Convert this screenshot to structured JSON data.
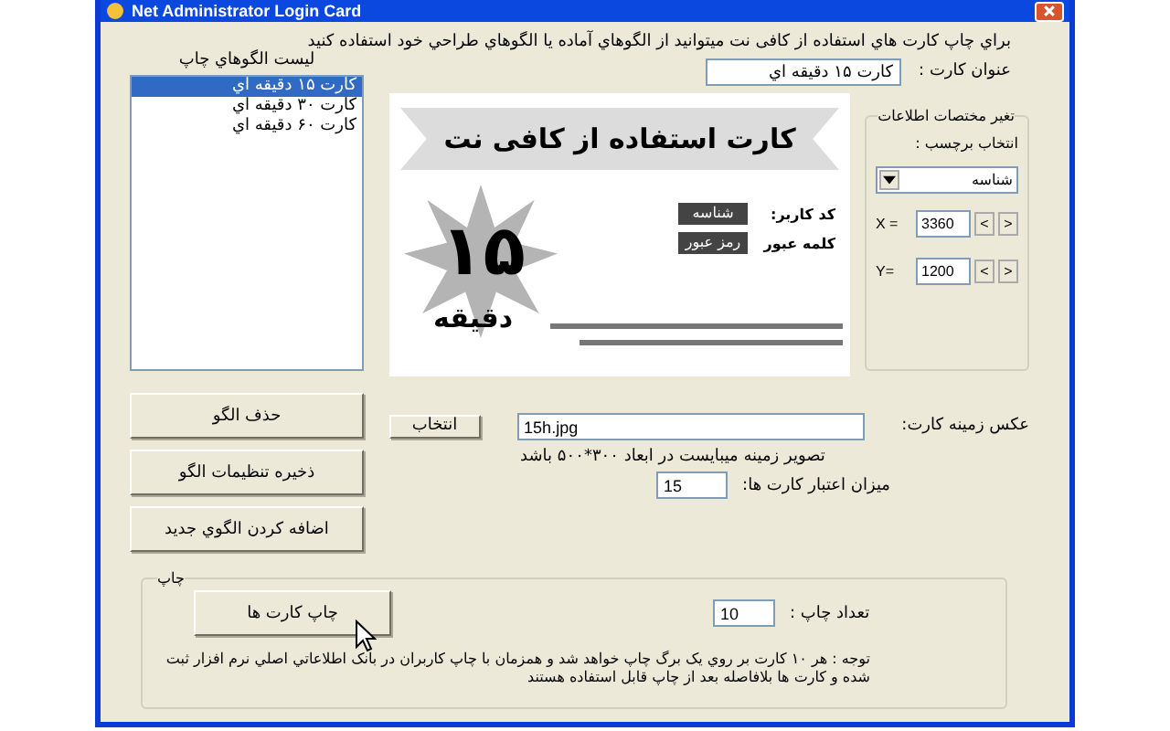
{
  "window": {
    "title": "Net Administrator Login Card"
  },
  "intro": "براي چاپ کارت هاي استفاده از کافی نت میتوانید از الگوهاي آماده یا الگوهاي طراحي خود استفاده کنيد",
  "templates": {
    "heading": "لیست الگوهاي چاپ",
    "items": [
      {
        "label": "کارت ۱۵ دقیقه اي",
        "selected": true
      },
      {
        "label": "کارت ۳۰ دقیقه اي",
        "selected": false
      },
      {
        "label": "کارت ۶۰ دقیقه اي",
        "selected": false
      }
    ]
  },
  "template_buttons": [
    "حذف الگو",
    "ذخیره تنظیمات الگو",
    "اضافه کردن الگوي جدید"
  ],
  "card_title": {
    "label": "عنوان کارت :",
    "value": "کارت ۱۵ دقیقه اي"
  },
  "card_preview": {
    "heading": "کارت استفاده از کافی نت",
    "number": "۱۵",
    "unit": "دقیقه",
    "fields": [
      {
        "label": "کد کاربر:",
        "tag": "شناسه"
      },
      {
        "label": "کلمه عبور",
        "tag": "رمز عبور"
      }
    ]
  },
  "coordinates": {
    "legend": "تغیر مختصات اطلاعات",
    "select_label": "انتخاب برچسب :",
    "select_value": "شناسه",
    "axes": [
      {
        "label": "X =",
        "value": "3360",
        "prev": "<",
        "next": ">"
      },
      {
        "label": "Y=",
        "value": "1200",
        "prev": "<",
        "next": ">"
      }
    ]
  },
  "background": {
    "label": "عکس زمینه کارت:",
    "value": "15h.jpg",
    "browse": "انتخاب",
    "hint": "تصویر زمینه میبایست در ابعاد ۳۰۰*۵۰۰ باشد"
  },
  "validity": {
    "label": "میزان اعتبار کارت ها:",
    "value": "15"
  },
  "print": {
    "legend": "چاپ",
    "button": "چاپ کارت ها",
    "count_label": "تعداد چاپ :",
    "count": "10",
    "note": "توجه : هر ۱۰ کارت بر روي یک برگ چاپ خواهد شد و همزمان با چاپ کاربران در بانک اطلاعاتي اصلي نرم افزار ثبت شده و کارت ها بلافاصله بعد از چاپ قابل استفاده هستند"
  }
}
